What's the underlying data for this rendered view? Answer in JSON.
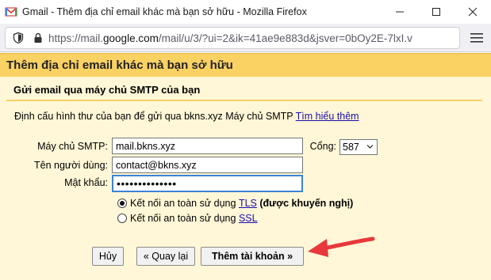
{
  "window": {
    "title": "Gmail - Thêm địa chỉ email khác mà bạn sở hữu - Mozilla Firefox"
  },
  "urlbar": {
    "prefix": "https://mail.",
    "host": "google.com",
    "path": "/mail/u/3/?ui=2&ik=41ae9e883d&jsver=0bOy2E-7lxI.v"
  },
  "dialog": {
    "title": "Thêm địa chỉ email khác mà bạn sở hữu",
    "section_heading": "Gửi email qua máy chủ SMTP của bạn",
    "description": "Định cấu hình thư của bạn để gửi qua bkns.xyz Máy chủ SMTP",
    "learn_more": "Tìm hiểu thêm"
  },
  "form": {
    "smtp_label": "Máy chủ SMTP:",
    "smtp_value": "mail.bkns.xyz",
    "port_label": "Cổng:",
    "port_value": "587",
    "username_label": "Tên người dùng:",
    "username_value": "contact@bkns.xyz",
    "password_label": "Mật khẩu:",
    "password_value": "••••••••••••••",
    "radio_tls_prefix": "Kết nối an toàn sử dụng",
    "radio_tls_link": "TLS",
    "radio_tls_note": "(được khuyến nghị)",
    "radio_ssl_prefix": "Kết nối an toàn sử dụng",
    "radio_ssl_link": "SSL",
    "selected_security": "TLS"
  },
  "buttons": {
    "cancel": "Hủy",
    "back": "« Quay lại",
    "add_account": "Thêm tài khoản »"
  },
  "colors": {
    "dialog_header": "#fad163",
    "dialog_body": "#fff7d7",
    "annotation_arrow": "#e8383d",
    "link": "#1a0dab"
  }
}
